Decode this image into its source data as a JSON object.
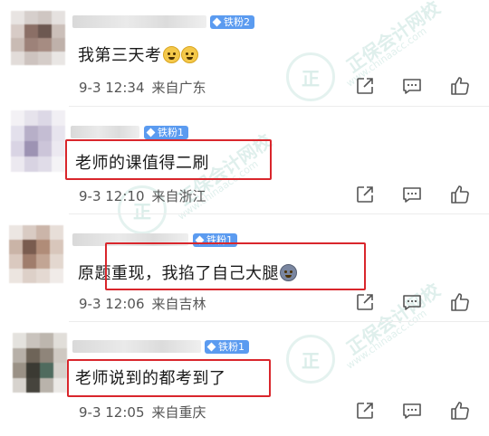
{
  "watermark": {
    "brand": "正保会计网校",
    "url": "www.chinaacc.com",
    "mark": "正"
  },
  "comments": [
    {
      "badge": "铁粉2",
      "text": "我第三天考",
      "emoji": [
        "crying-face",
        "crying-face"
      ],
      "time": "9-3 12:34",
      "location": "来自广东",
      "highlighted": false
    },
    {
      "badge": "铁粉1",
      "text": "老师的课值得二刷",
      "emoji": [],
      "time": "9-3 12:10",
      "location": "来自浙江",
      "highlighted": true
    },
    {
      "badge": "铁粉1",
      "text": "原题重现，我掐了自己大腿",
      "emoji": [
        "shocked-face"
      ],
      "time": "9-3 12:06",
      "location": "来自吉林",
      "highlighted": true
    },
    {
      "badge": "铁粉1",
      "text": "老师说到的都考到了",
      "emoji": [],
      "time": "9-3 12:05",
      "location": "来自重庆",
      "highlighted": true
    }
  ],
  "actions": [
    "share-icon",
    "comment-icon",
    "like-icon"
  ],
  "colors": {
    "highlight": "#d9262c",
    "badge": "#5b9bf0",
    "text": "#1a1a1a",
    "meta": "#555555"
  }
}
